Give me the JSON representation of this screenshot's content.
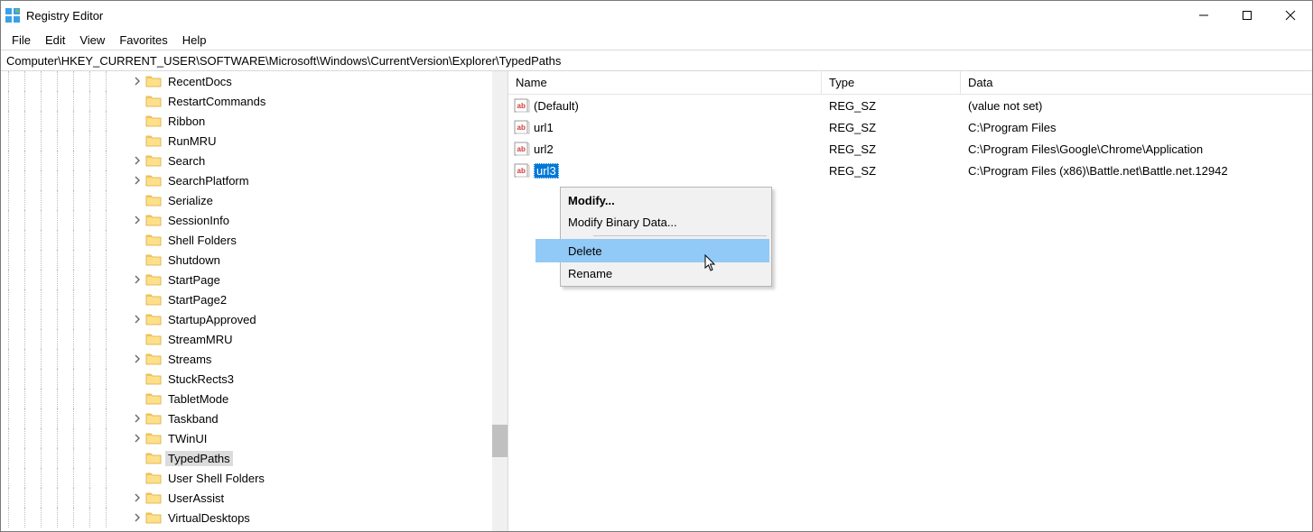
{
  "titlebar": {
    "title": "Registry Editor"
  },
  "menu": [
    "File",
    "Edit",
    "View",
    "Favorites",
    "Help"
  ],
  "address": "Computer\\HKEY_CURRENT_USER\\SOFTWARE\\Microsoft\\Windows\\CurrentVersion\\Explorer\\TypedPaths",
  "tree": [
    {
      "label": "RecentDocs",
      "expander": "collapsed",
      "selected": false
    },
    {
      "label": "RestartCommands",
      "expander": "none",
      "selected": false
    },
    {
      "label": "Ribbon",
      "expander": "none",
      "selected": false
    },
    {
      "label": "RunMRU",
      "expander": "none",
      "selected": false
    },
    {
      "label": "Search",
      "expander": "collapsed",
      "selected": false
    },
    {
      "label": "SearchPlatform",
      "expander": "collapsed",
      "selected": false
    },
    {
      "label": "Serialize",
      "expander": "none",
      "selected": false
    },
    {
      "label": "SessionInfo",
      "expander": "collapsed",
      "selected": false
    },
    {
      "label": "Shell Folders",
      "expander": "none",
      "selected": false
    },
    {
      "label": "Shutdown",
      "expander": "none",
      "selected": false
    },
    {
      "label": "StartPage",
      "expander": "collapsed",
      "selected": false
    },
    {
      "label": "StartPage2",
      "expander": "none",
      "selected": false
    },
    {
      "label": "StartupApproved",
      "expander": "collapsed",
      "selected": false
    },
    {
      "label": "StreamMRU",
      "expander": "none",
      "selected": false
    },
    {
      "label": "Streams",
      "expander": "collapsed",
      "selected": false
    },
    {
      "label": "StuckRects3",
      "expander": "none",
      "selected": false
    },
    {
      "label": "TabletMode",
      "expander": "none",
      "selected": false
    },
    {
      "label": "Taskband",
      "expander": "collapsed",
      "selected": false
    },
    {
      "label": "TWinUI",
      "expander": "collapsed",
      "selected": false
    },
    {
      "label": "TypedPaths",
      "expander": "none",
      "selected": true
    },
    {
      "label": "User Shell Folders",
      "expander": "none",
      "selected": false
    },
    {
      "label": "UserAssist",
      "expander": "collapsed",
      "selected": false
    },
    {
      "label": "VirtualDesktops",
      "expander": "collapsed",
      "selected": false
    }
  ],
  "columns": {
    "name": "Name",
    "type": "Type",
    "data": "Data"
  },
  "values": [
    {
      "name": "(Default)",
      "type": "REG_SZ",
      "data": "(value not set)",
      "selected": false
    },
    {
      "name": "url1",
      "type": "REG_SZ",
      "data": "C:\\Program Files",
      "selected": false
    },
    {
      "name": "url2",
      "type": "REG_SZ",
      "data": "C:\\Program Files\\Google\\Chrome\\Application",
      "selected": false
    },
    {
      "name": "url3",
      "type": "REG_SZ",
      "data": "C:\\Program Files (x86)\\Battle.net\\Battle.net.12942",
      "selected": true
    }
  ],
  "contextMenu": {
    "modify": "Modify...",
    "modifyBinary": "Modify Binary Data...",
    "delete": "Delete",
    "rename": "Rename"
  }
}
